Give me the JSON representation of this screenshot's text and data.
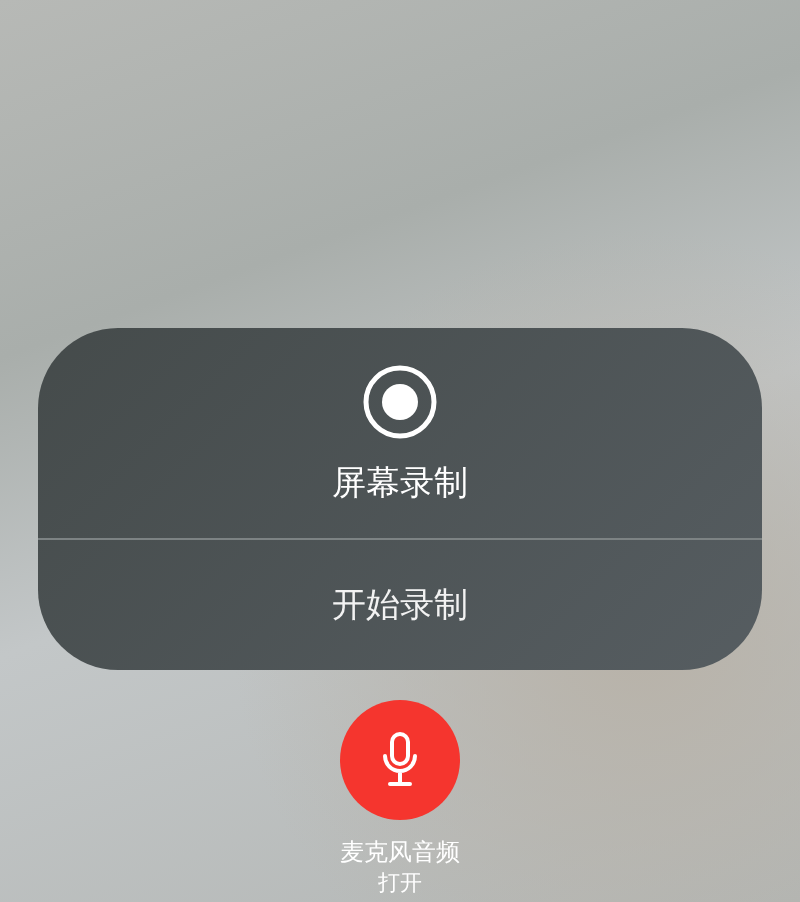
{
  "panel": {
    "title": "屏幕录制",
    "action": "开始录制"
  },
  "microphone": {
    "label": "麦克风音频",
    "status": "打开",
    "on": true
  }
}
